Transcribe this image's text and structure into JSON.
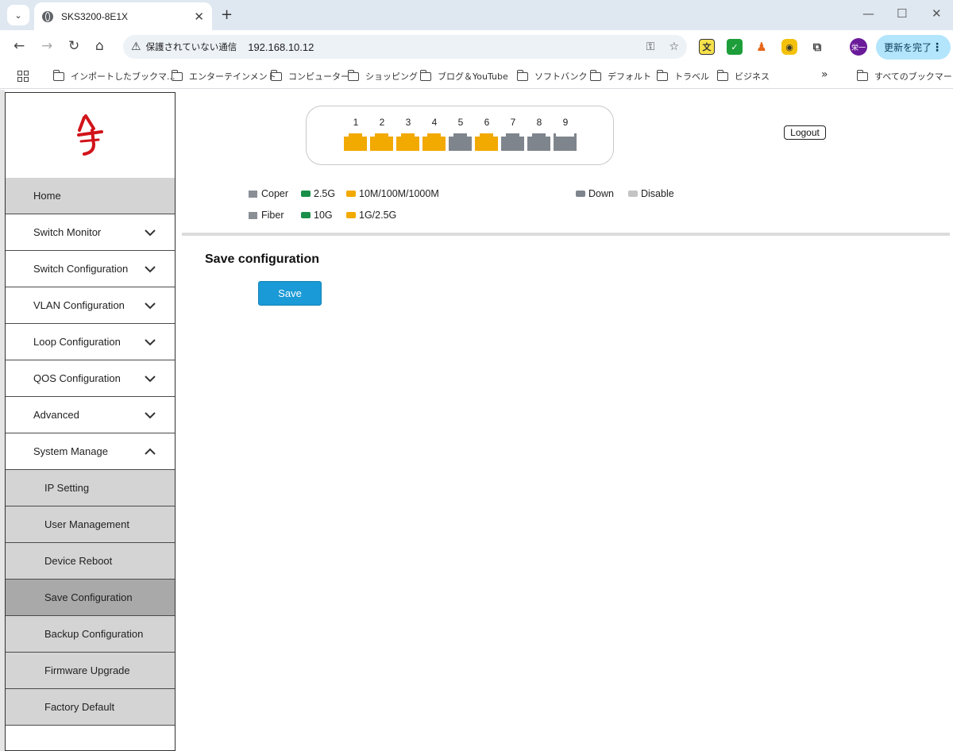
{
  "browser": {
    "tab_title": "SKS3200-8E1X",
    "security_text": "保護されていない通信",
    "url": "192.168.10.12",
    "avatar_text": "栄一",
    "update_label": "更新を完了",
    "bookmarks": [
      "インポートしたブックマ...",
      "エンターテインメント",
      "コンピューター",
      "ショッピング",
      "ブログ＆YouTube",
      "ソフトバンク",
      "デフォルト",
      "トラベル",
      "ビジネス"
    ],
    "all_bookmarks": "すべてのブックマーク"
  },
  "sidebar": {
    "home": "Home",
    "menu": [
      {
        "label": "Switch Monitor",
        "expanded": false
      },
      {
        "label": "Switch Configuration",
        "expanded": false
      },
      {
        "label": "VLAN Configuration",
        "expanded": false
      },
      {
        "label": "Loop Configuration",
        "expanded": false
      },
      {
        "label": "QOS Configuration",
        "expanded": false
      },
      {
        "label": "Advanced",
        "expanded": false
      },
      {
        "label": "System Manage",
        "expanded": true
      }
    ],
    "submenu": [
      {
        "label": "IP Setting",
        "active": false
      },
      {
        "label": "User Management",
        "active": false
      },
      {
        "label": "Device Reboot",
        "active": false
      },
      {
        "label": "Save Configuration",
        "active": true
      },
      {
        "label": "Backup Configuration",
        "active": false
      },
      {
        "label": "Firmware Upgrade",
        "active": false
      },
      {
        "label": "Factory Default",
        "active": false
      }
    ]
  },
  "ports": [
    {
      "num": "1",
      "status": "1G/2.5G"
    },
    {
      "num": "2",
      "status": "1G/2.5G"
    },
    {
      "num": "3",
      "status": "1G/2.5G"
    },
    {
      "num": "4",
      "status": "1G/2.5G"
    },
    {
      "num": "5",
      "status": "Down"
    },
    {
      "num": "6",
      "status": "1G/2.5G"
    },
    {
      "num": "7",
      "status": "Down"
    },
    {
      "num": "8",
      "status": "Down"
    },
    {
      "num": "9",
      "status": "Down",
      "type": "Fiber"
    }
  ],
  "logout_label": "Logout",
  "legend": {
    "coper": "Coper",
    "fiber": "Fiber",
    "speed_2_5g": "2.5G",
    "speed_10g": "10G",
    "speed_10m_1000m": "10M/100M/1000M",
    "speed_1g_2_5g": "1G/2.5G",
    "down": "Down",
    "disable": "Disable"
  },
  "colors": {
    "port_up": "#f2a900",
    "port_down": "#7f858c",
    "green": "#1a8f4a",
    "disable": "#c4c4c4",
    "save_button": "#1a9ad6",
    "logo_red": "#d1131a"
  },
  "main": {
    "section_title": "Save configuration",
    "save_label": "Save"
  }
}
